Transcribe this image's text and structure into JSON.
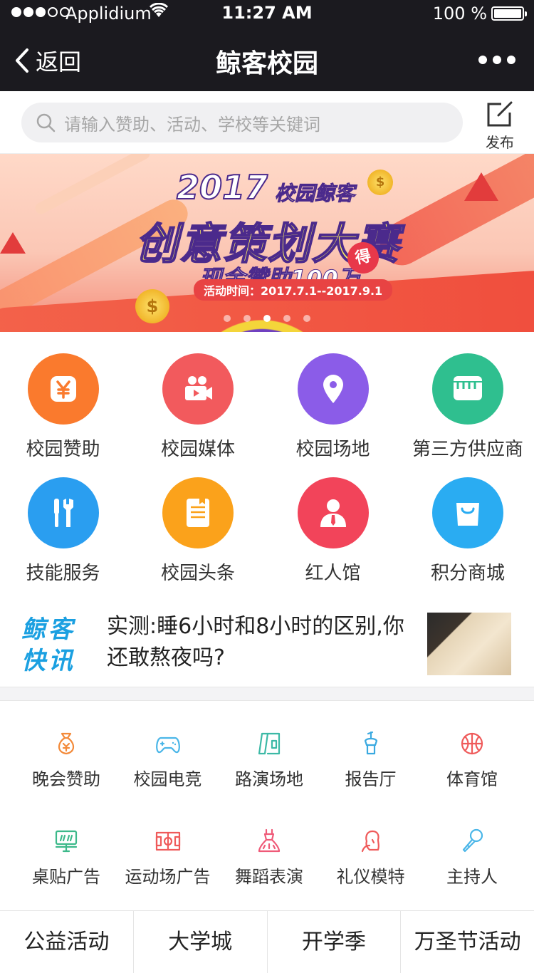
{
  "status_bar": {
    "carrier": "Applidium",
    "time": "11:27 AM",
    "battery": "100 %"
  },
  "nav": {
    "back_label": "返回",
    "title": "鲸客校园"
  },
  "search": {
    "placeholder": "请输入赞助、活动、学校等关键词",
    "publish_label": "发布"
  },
  "banner": {
    "year": "2017",
    "subtitle": "校园鲸客",
    "title": "创意策划大赛",
    "cash": "现金赞助100万",
    "badge": "得",
    "time": "活动时间：2017.7.1--2017.9.1",
    "page_count": 5,
    "active_page": 3
  },
  "categories": [
    {
      "label": "校园赞助",
      "icon": "yen-icon",
      "color": "#fa7a2d"
    },
    {
      "label": "校园媒体",
      "icon": "video-camera-icon",
      "color": "#f25a5d"
    },
    {
      "label": "校园场地",
      "icon": "location-pin-icon",
      "color": "#8b5ce8"
    },
    {
      "label": "第三方供应商",
      "icon": "store-icon",
      "color": "#2fbf8f"
    },
    {
      "label": "技能服务",
      "icon": "tools-icon",
      "color": "#2a9ef0"
    },
    {
      "label": "校园头条",
      "icon": "newspaper-icon",
      "color": "#fba21b"
    },
    {
      "label": "红人馆",
      "icon": "person-icon",
      "color": "#f2445a"
    },
    {
      "label": "积分商城",
      "icon": "shopping-bag-icon",
      "color": "#2aacf2"
    }
  ],
  "news": {
    "logo_line1": "鲸客",
    "logo_line2": "快讯",
    "headline": "实测:睡6小时和8小时的区别,你还敢熬夜吗?"
  },
  "services": [
    {
      "label": "晚会赞助",
      "icon": "money-bag-icon",
      "color": "#f38a3a"
    },
    {
      "label": "校园电竞",
      "icon": "gamepad-icon",
      "color": "#4ab6e8"
    },
    {
      "label": "路演场地",
      "icon": "stage-icon",
      "color": "#3cb9a6"
    },
    {
      "label": "报告厅",
      "icon": "podium-icon",
      "color": "#3aa9e0"
    },
    {
      "label": "体育馆",
      "icon": "basketball-icon",
      "color": "#ef5a5a"
    },
    {
      "label": "桌贴广告",
      "icon": "desk-sticker-icon",
      "color": "#3cb98a"
    },
    {
      "label": "运动场广告",
      "icon": "sports-field-icon",
      "color": "#ef5a5a"
    },
    {
      "label": "舞蹈表演",
      "icon": "dress-icon",
      "color": "#ef5a78"
    },
    {
      "label": "礼仪模特",
      "icon": "model-icon",
      "color": "#ef5a5a"
    },
    {
      "label": "主持人",
      "icon": "microphone-icon",
      "color": "#4ab6e8"
    }
  ],
  "bottom_tabs": [
    {
      "label": "公益活动"
    },
    {
      "label": "大学城"
    },
    {
      "label": "开学季"
    },
    {
      "label": "万圣节活动"
    }
  ]
}
